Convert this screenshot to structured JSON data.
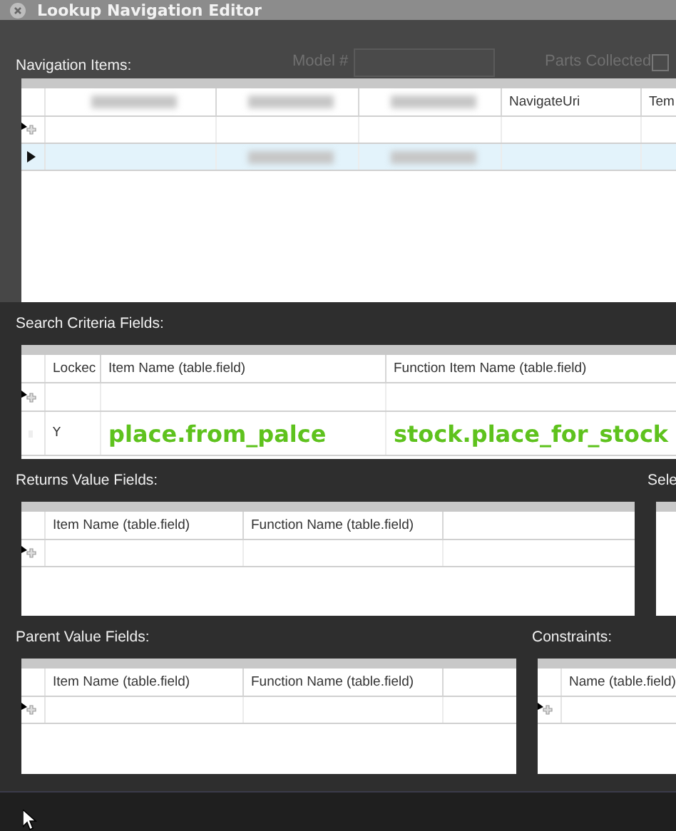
{
  "window": {
    "title": "Lookup Navigation Editor"
  },
  "background_form": {
    "model_label": "Model #",
    "parts_collected_label": "Parts Collected",
    "parts_collected_checked": false
  },
  "navigation_items": {
    "label": "Navigation Items:",
    "columns": [
      {
        "blurred": true
      },
      {
        "blurred": true
      },
      {
        "blurred": true
      },
      {
        "header": "NavigateUri",
        "blurred": false
      },
      {
        "header": "Tem",
        "blurred": false
      }
    ],
    "rows": [
      {
        "kind": "new",
        "selected": false,
        "cells": []
      },
      {
        "kind": "blurred",
        "selected": true,
        "cells": []
      }
    ]
  },
  "search_criteria_fields": {
    "label": "Search Criteria Fields:",
    "columns": [
      {
        "header": "Lockec"
      },
      {
        "header": "Item Name (table.field)"
      },
      {
        "header": "Function Item Name (table.field)"
      }
    ],
    "rows": [
      {
        "kind": "new",
        "cells": []
      },
      {
        "kind": "data",
        "cells": [
          "Y",
          "place.from_palce",
          "stock.place_for_stock"
        ]
      }
    ]
  },
  "returns_value_fields": {
    "label": "Returns Value Fields:",
    "columns": [
      {
        "header": "Item Name (table.field)"
      },
      {
        "header": "Function Name (table.field)"
      },
      {}
    ],
    "rows": [
      {
        "kind": "new",
        "cells": []
      }
    ]
  },
  "selected_panel": {
    "label": "Sele"
  },
  "parent_value_fields": {
    "label": "Parent Value Fields:",
    "columns": [
      {
        "header": "Item Name (table.field)"
      },
      {
        "header": "Function Name (table.field)"
      },
      {}
    ],
    "rows": [
      {
        "kind": "new",
        "cells": []
      }
    ]
  },
  "constraints": {
    "label": "Constraints:",
    "columns": [
      {
        "header": "Name (table.field)"
      }
    ],
    "rows": [
      {
        "kind": "new",
        "cells": []
      }
    ]
  }
}
